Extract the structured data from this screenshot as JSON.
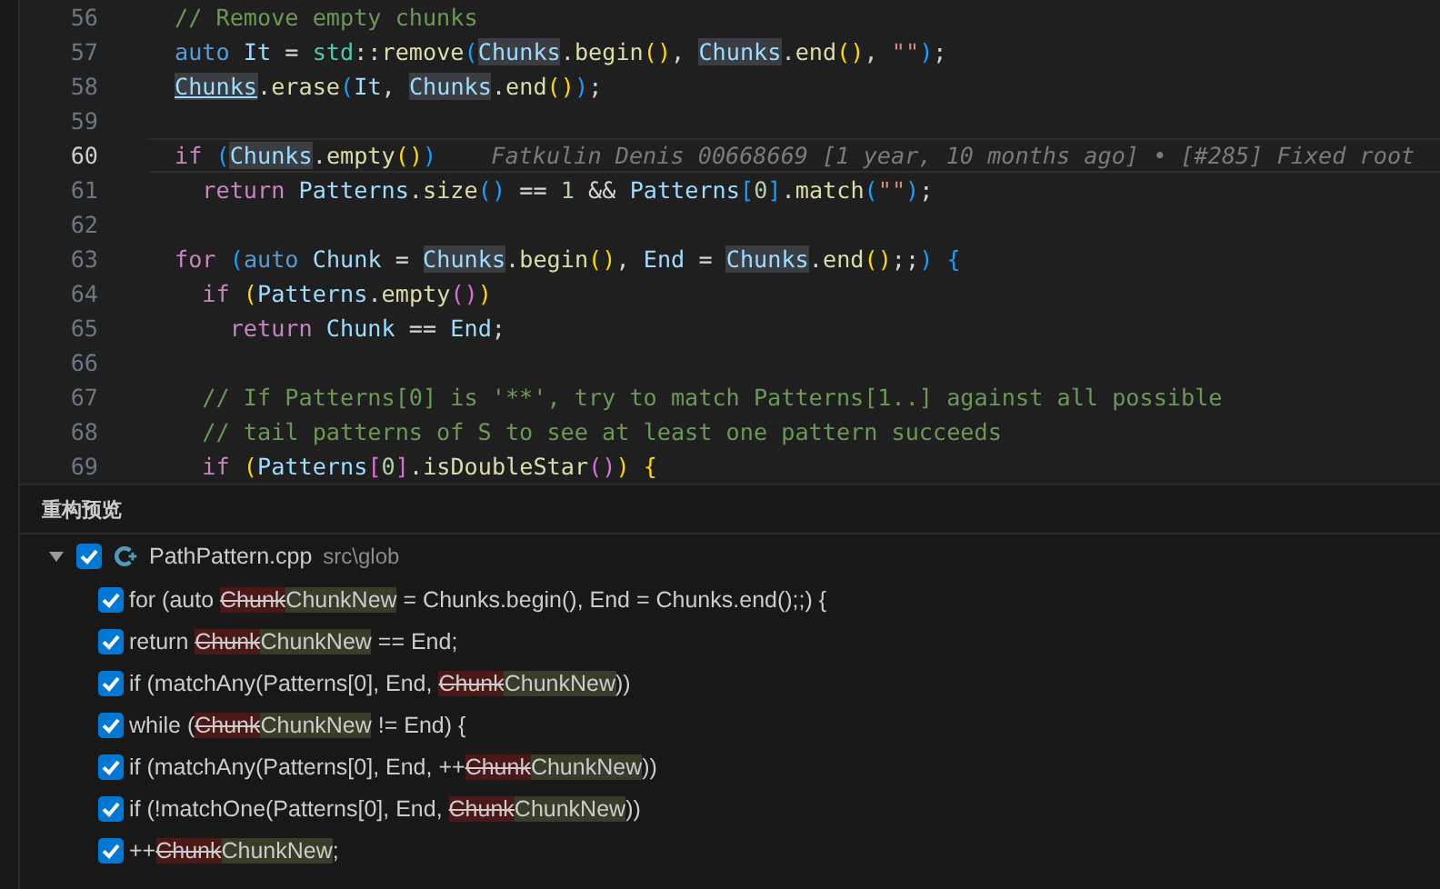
{
  "editor": {
    "lines": [
      {
        "number": "56",
        "current": false,
        "tokens": [
          {
            "kind": "comment",
            "text": "// Remove empty chunks"
          }
        ]
      },
      {
        "number": "57",
        "current": false,
        "tokens": [
          {
            "kind": "keyword",
            "text": "auto "
          },
          {
            "kind": "variable",
            "text": "It"
          },
          {
            "kind": "plain",
            "text": " = "
          },
          {
            "kind": "type",
            "text": "std"
          },
          {
            "kind": "plain",
            "text": "::"
          },
          {
            "kind": "function",
            "text": "remove"
          },
          {
            "kind": "bracket3",
            "text": "("
          },
          {
            "kind": "highlight",
            "text": "Chunks"
          },
          {
            "kind": "plain",
            "text": "."
          },
          {
            "kind": "function",
            "text": "begin"
          },
          {
            "kind": "bracket1",
            "text": "()"
          },
          {
            "kind": "plain",
            "text": ", "
          },
          {
            "kind": "highlight",
            "text": "Chunks"
          },
          {
            "kind": "plain",
            "text": "."
          },
          {
            "kind": "function",
            "text": "end"
          },
          {
            "kind": "bracket1",
            "text": "()"
          },
          {
            "kind": "plain",
            "text": ", "
          },
          {
            "kind": "string",
            "text": "\"\""
          },
          {
            "kind": "bracket3",
            "text": ")"
          },
          {
            "kind": "plain",
            "text": ";"
          }
        ]
      },
      {
        "number": "58",
        "current": false,
        "tokens": [
          {
            "kind": "underline",
            "text": "Chunks"
          },
          {
            "kind": "plain",
            "text": "."
          },
          {
            "kind": "function",
            "text": "erase"
          },
          {
            "kind": "bracket3",
            "text": "("
          },
          {
            "kind": "variable",
            "text": "It"
          },
          {
            "kind": "plain",
            "text": ", "
          },
          {
            "kind": "highlight",
            "text": "Chunks"
          },
          {
            "kind": "plain",
            "text": "."
          },
          {
            "kind": "function",
            "text": "end"
          },
          {
            "kind": "bracket1",
            "text": "()"
          },
          {
            "kind": "bracket3",
            "text": ")"
          },
          {
            "kind": "plain",
            "text": ";"
          }
        ]
      },
      {
        "number": "59",
        "current": false
      },
      {
        "number": "60",
        "current": true,
        "blame": "Fatkulin Denis 00668669 [1 year, 10 months ago] • [#285] Fixed root",
        "tokens": [
          {
            "kind": "control",
            "text": "if "
          },
          {
            "kind": "bracket3",
            "text": "("
          },
          {
            "kind": "highlight",
            "text": "Chunks"
          },
          {
            "kind": "plain",
            "text": "."
          },
          {
            "kind": "function",
            "text": "empty"
          },
          {
            "kind": "bracket1",
            "text": "()"
          },
          {
            "kind": "bracket3",
            "text": ")"
          }
        ]
      },
      {
        "number": "61",
        "current": false,
        "tokens": [
          {
            "kind": "control",
            "text": "  return "
          },
          {
            "kind": "variable",
            "text": "Patterns"
          },
          {
            "kind": "plain",
            "text": "."
          },
          {
            "kind": "function",
            "text": "size"
          },
          {
            "kind": "bracket3",
            "text": "()"
          },
          {
            "kind": "plain",
            "text": " == "
          },
          {
            "kind": "number",
            "text": "1"
          },
          {
            "kind": "plain",
            "text": " && "
          },
          {
            "kind": "variable",
            "text": "Patterns"
          },
          {
            "kind": "bracket3",
            "text": "["
          },
          {
            "kind": "number",
            "text": "0"
          },
          {
            "kind": "bracket3",
            "text": "]"
          },
          {
            "kind": "plain",
            "text": "."
          },
          {
            "kind": "function",
            "text": "match"
          },
          {
            "kind": "bracket3",
            "text": "("
          },
          {
            "kind": "string",
            "text": "\"\""
          },
          {
            "kind": "bracket3",
            "text": ")"
          },
          {
            "kind": "plain",
            "text": ";"
          }
        ]
      },
      {
        "number": "62",
        "current": false
      },
      {
        "number": "63",
        "current": false,
        "tokens": [
          {
            "kind": "control",
            "text": "for "
          },
          {
            "kind": "bracket3",
            "text": "("
          },
          {
            "kind": "keyword",
            "text": "auto "
          },
          {
            "kind": "variable",
            "text": "Chunk"
          },
          {
            "kind": "plain",
            "text": " = "
          },
          {
            "kind": "highlight",
            "text": "Chunks"
          },
          {
            "kind": "plain",
            "text": "."
          },
          {
            "kind": "function",
            "text": "begin"
          },
          {
            "kind": "bracket1",
            "text": "()"
          },
          {
            "kind": "plain",
            "text": ", "
          },
          {
            "kind": "variable",
            "text": "End"
          },
          {
            "kind": "plain",
            "text": " = "
          },
          {
            "kind": "highlight",
            "text": "Chunks"
          },
          {
            "kind": "plain",
            "text": "."
          },
          {
            "kind": "function",
            "text": "end"
          },
          {
            "kind": "bracket1",
            "text": "()"
          },
          {
            "kind": "plain",
            "text": ";;"
          },
          {
            "kind": "bracket3",
            "text": ") {"
          }
        ]
      },
      {
        "number": "64",
        "current": false,
        "tokens": [
          {
            "kind": "control",
            "text": "  if "
          },
          {
            "kind": "bracket1",
            "text": "("
          },
          {
            "kind": "variable",
            "text": "Patterns"
          },
          {
            "kind": "plain",
            "text": "."
          },
          {
            "kind": "function",
            "text": "empty"
          },
          {
            "kind": "bracket2",
            "text": "()"
          },
          {
            "kind": "bracket1",
            "text": ")"
          }
        ]
      },
      {
        "number": "65",
        "current": false,
        "tokens": [
          {
            "kind": "control",
            "text": "    return "
          },
          {
            "kind": "variable",
            "text": "Chunk"
          },
          {
            "kind": "plain",
            "text": " == "
          },
          {
            "kind": "variable",
            "text": "End"
          },
          {
            "kind": "plain",
            "text": ";"
          }
        ]
      },
      {
        "number": "66",
        "current": false
      },
      {
        "number": "67",
        "current": false,
        "tokens": [
          {
            "kind": "comment",
            "text": "  // If Patterns[0] is '**', try to match Patterns[1..] against all possible"
          }
        ]
      },
      {
        "number": "68",
        "current": false,
        "tokens": [
          {
            "kind": "comment",
            "text": "  // tail patterns of S to see at least one pattern succeeds"
          }
        ]
      },
      {
        "number": "69",
        "current": false,
        "tokens": [
          {
            "kind": "control",
            "text": "  if "
          },
          {
            "kind": "bracket1",
            "text": "("
          },
          {
            "kind": "variable",
            "text": "Patterns"
          },
          {
            "kind": "bracket2",
            "text": "["
          },
          {
            "kind": "number",
            "text": "0"
          },
          {
            "kind": "bracket2",
            "text": "]"
          },
          {
            "kind": "plain",
            "text": "."
          },
          {
            "kind": "function",
            "text": "isDoubleStar"
          },
          {
            "kind": "bracket2",
            "text": "()"
          },
          {
            "kind": "bracket1",
            "text": ") {"
          }
        ]
      }
    ]
  },
  "panel": {
    "title": "重构预览",
    "file": {
      "expanded": true,
      "checked": true,
      "name": "PathPattern.cpp",
      "path": "src\\glob",
      "children": [
        {
          "checked": true,
          "before": "for (auto ",
          "removed": "Chunk",
          "added": "ChunkNew",
          "after": " = Chunks.begin(), End = Chunks.end();;) {"
        },
        {
          "checked": true,
          "before": "return ",
          "removed": "Chunk",
          "added": "ChunkNew",
          "after": " == End;"
        },
        {
          "checked": true,
          "before": "if (matchAny(Patterns[0], End, ",
          "removed": "Chunk",
          "added": "ChunkNew",
          "after": "))"
        },
        {
          "checked": true,
          "before": "while (",
          "removed": "Chunk",
          "added": "ChunkNew",
          "after": " != End) {"
        },
        {
          "checked": true,
          "before": "if (matchAny(Patterns[0], End, ++",
          "removed": "Chunk",
          "added": "ChunkNew",
          "after": "))"
        },
        {
          "checked": true,
          "before": "if (!matchOne(Patterns[0], End, ",
          "removed": "Chunk",
          "added": "ChunkNew",
          "after": "))"
        },
        {
          "checked": true,
          "before": "++",
          "removed": "Chunk",
          "added": "ChunkNew",
          "after": ";"
        }
      ]
    }
  }
}
